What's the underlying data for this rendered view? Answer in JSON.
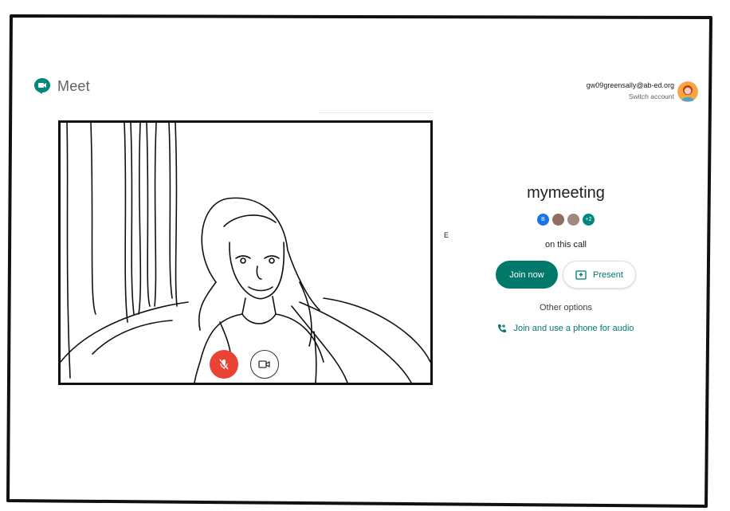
{
  "app": {
    "name": "Meet"
  },
  "account": {
    "email": "gw09greensally@ab-ed.org",
    "switch_label": "Switch account"
  },
  "preview": {
    "mic_state": "muted",
    "camera_state": "on"
  },
  "stray_glyph": "E",
  "meeting": {
    "title": "mymeeting",
    "participants": [
      {
        "initial": "B",
        "color": "#1a73e8"
      },
      {
        "initial": "",
        "color": "#8d6e63"
      },
      {
        "initial": "",
        "color": "#a1887f"
      },
      {
        "initial": "+2",
        "color": "#00897b"
      }
    ],
    "on_call_label": "on this call",
    "join_label": "Join now",
    "present_label": "Present",
    "other_options_label": "Other options",
    "phone_label": "Join and use a phone for audio"
  },
  "colors": {
    "accent": "#00796b",
    "mic_muted": "#ea4335"
  },
  "icons": [
    "meet-logo-icon",
    "mic-off-icon",
    "camera-icon",
    "present-screen-icon",
    "phone-add-icon"
  ]
}
